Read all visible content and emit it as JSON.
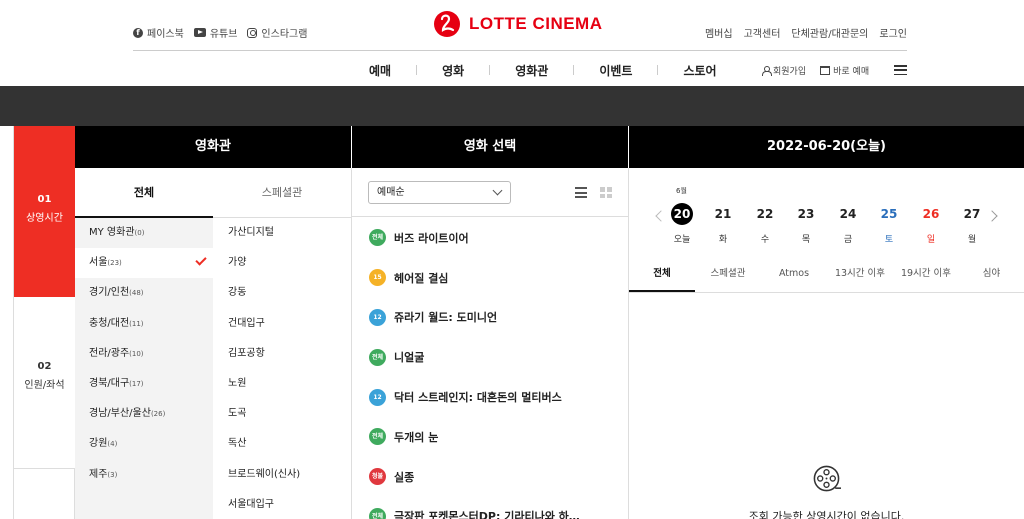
{
  "header": {
    "social": [
      {
        "icon": "facebook-icon",
        "label": "페이스북"
      },
      {
        "icon": "youtube-icon",
        "label": "유튜브"
      },
      {
        "icon": "instagram-icon",
        "label": "인스타그램"
      }
    ],
    "logo_text": "LOTTE CINEMA",
    "util_links": [
      "멤버십",
      "고객센터",
      "단체관람/대관문의",
      "로그인"
    ],
    "gnb": [
      "예매",
      "영화",
      "영화관",
      "이벤트",
      "스토어"
    ],
    "signup": "회원가입",
    "quick_booking": "바로 예매",
    "brand_color": "#e60012"
  },
  "steps": [
    {
      "num": "01",
      "label": "상영시간",
      "active": true
    },
    {
      "num": "02",
      "label": "인원/좌석",
      "active": false
    }
  ],
  "theater": {
    "title": "영화관",
    "tabs": [
      "전체",
      "스페셜관"
    ],
    "regions": [
      {
        "name": "MY 영화관",
        "count": "(0)"
      },
      {
        "name": "서울",
        "count": "(23)",
        "selected": true
      },
      {
        "name": "경기/인천",
        "count": "(48)"
      },
      {
        "name": "충청/대전",
        "count": "(11)"
      },
      {
        "name": "전라/광주",
        "count": "(10)"
      },
      {
        "name": "경북/대구",
        "count": "(17)"
      },
      {
        "name": "경남/부산/울산",
        "count": "(26)"
      },
      {
        "name": "강원",
        "count": "(4)"
      },
      {
        "name": "제주",
        "count": "(3)"
      }
    ],
    "branches": [
      "가산디지털",
      "가양",
      "강동",
      "건대입구",
      "김포공항",
      "노원",
      "도곡",
      "독산",
      "브로드웨이(신사)",
      "서울대입구"
    ]
  },
  "movie": {
    "title": "영화 선택",
    "sort": "예매순",
    "list": [
      {
        "rating": "전체",
        "color": "#3faa5e",
        "title": "버즈 라이트이어"
      },
      {
        "rating": "15",
        "color": "#f5b227",
        "title": "헤어질 결심"
      },
      {
        "rating": "12",
        "color": "#3aa2d8",
        "title": "쥬라기 월드: 도미니언"
      },
      {
        "rating": "전체",
        "color": "#3faa5e",
        "title": "니얼굴"
      },
      {
        "rating": "12",
        "color": "#3aa2d8",
        "title": "닥터 스트레인지: 대혼돈의 멀티버스"
      },
      {
        "rating": "전체",
        "color": "#3faa5e",
        "title": "두개의 눈"
      },
      {
        "rating": "청불",
        "color": "#e0383e",
        "title": "실종"
      },
      {
        "rating": "전체",
        "color": "#3faa5e",
        "title": "극장판 포켓몬스터DP: 기라티나와 하…"
      }
    ]
  },
  "schedule": {
    "title": "2022-06-20(오늘)",
    "month": "6월",
    "days": [
      {
        "d": "20",
        "w": "오늘",
        "type": "today"
      },
      {
        "d": "21",
        "w": "화",
        "type": ""
      },
      {
        "d": "22",
        "w": "수",
        "type": ""
      },
      {
        "d": "23",
        "w": "목",
        "type": ""
      },
      {
        "d": "24",
        "w": "금",
        "type": ""
      },
      {
        "d": "25",
        "w": "토",
        "type": "sat"
      },
      {
        "d": "26",
        "w": "일",
        "type": "sun"
      },
      {
        "d": "27",
        "w": "월",
        "type": ""
      }
    ],
    "filters": [
      "전체",
      "스페셜관",
      "Atmos",
      "13시간 이후",
      "19시간 이후",
      "심야"
    ],
    "empty_message": "조회 가능한 상영시간이 없습니다."
  }
}
